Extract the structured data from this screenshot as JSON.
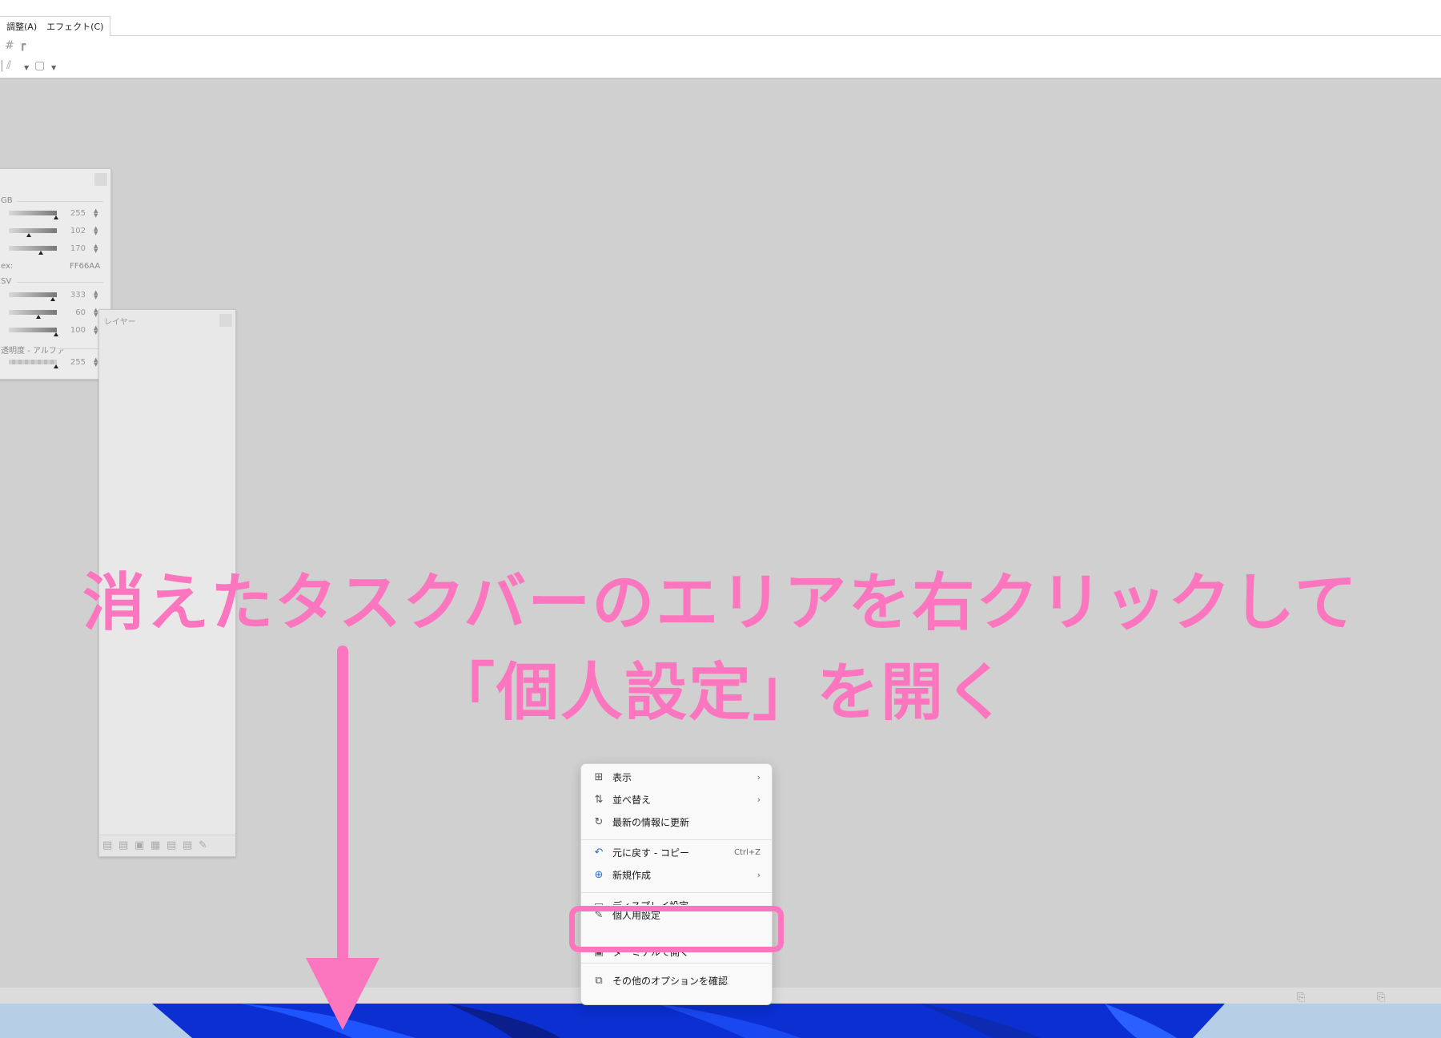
{
  "menu": {
    "tab_adjust": "調整(A)",
    "tab_effects": "エフェクト(C)"
  },
  "colors_panel": {
    "rgb_label": "GB",
    "rgb": [
      "255",
      "102",
      "170"
    ],
    "hex_label": "ex:",
    "hex_value": "FF66AA",
    "hsv_label": "SV",
    "hsv": [
      "333",
      "60",
      "100"
    ],
    "alpha_label": "透明度 - アルファ",
    "alpha": "255"
  },
  "layers_panel": {
    "title": "レイヤー"
  },
  "annotation": {
    "line1": "消えたタスクバーのエリアを右クリックして",
    "line2": "「個人設定」を開く",
    "color": "#fb76bf"
  },
  "context_menu": {
    "view": "表示",
    "sort": "並べ替え",
    "refresh": "最新の情報に更新",
    "undo": "元に戻す - コピー",
    "undo_shortcut": "Ctrl+Z",
    "new": "新規作成",
    "display_settings": "ディスプレイ設定",
    "personalize": "個人用設定",
    "terminal": "ターミナルで開く",
    "more_options": "その他のオプションを確認"
  }
}
